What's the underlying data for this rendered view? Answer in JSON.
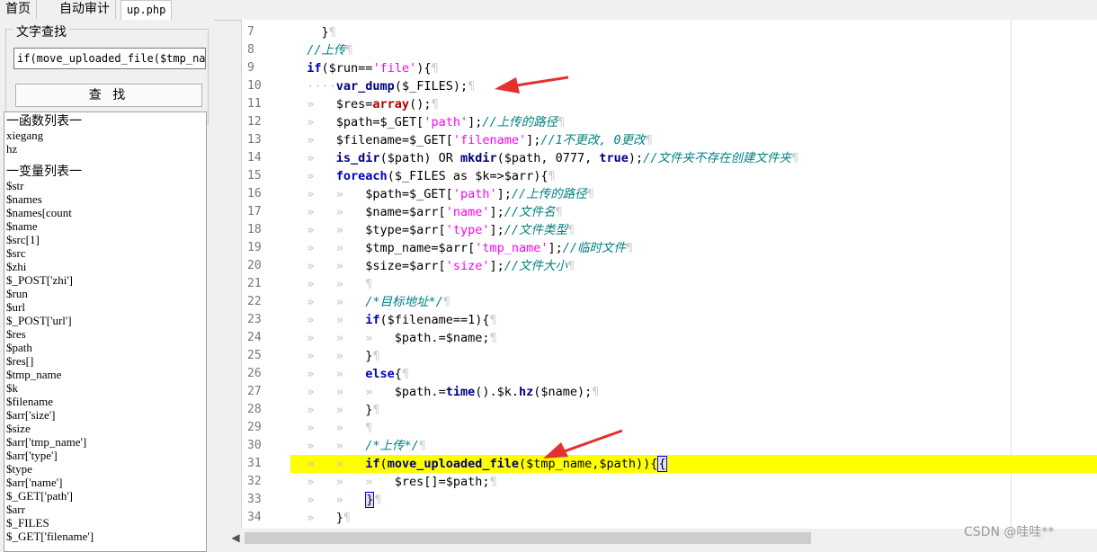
{
  "tabs": [
    "首页",
    "自动审计",
    "up.php"
  ],
  "search": {
    "legend": "文字查找",
    "value": "if(move_uploaded_file($tmp_name",
    "button": "查 找"
  },
  "functions": {
    "header": "一函数列表一",
    "items": [
      "xiegang",
      "hz"
    ]
  },
  "variables": {
    "header": "一变量列表一",
    "items": [
      "$str",
      "$names",
      "$names[count",
      "$name",
      "$src[1]",
      "$src",
      "$zhi",
      "$_POST['zhi']",
      "$run",
      "$url",
      "$_POST['url']",
      "$res",
      "$path",
      "$res[]",
      "$tmp_name",
      "$k",
      "$filename",
      "$arr['size']",
      "$size",
      "$arr['tmp_name']",
      "$arr['type']",
      "$type",
      "$arr['name']",
      "$_GET['path']",
      "$arr",
      "$_FILES",
      "$_GET['filename']"
    ]
  },
  "editor": {
    "line_numbers": [
      "7",
      "8",
      "9",
      "10",
      "11",
      "12",
      "13",
      "14",
      "15",
      "16",
      "17",
      "18",
      "19",
      "20",
      "21",
      "22",
      "23",
      "24",
      "25",
      "26",
      "27",
      "28",
      "29",
      "30",
      "31",
      "32",
      "33",
      "34"
    ],
    "highlight_line": "31"
  },
  "watermark": "CSDN @哇哇**",
  "colors": {
    "highlight": "#ffff00",
    "arrow": "#e53030",
    "keyword": "#0000c0",
    "string": "#ff00ff",
    "comment": "#008080"
  }
}
